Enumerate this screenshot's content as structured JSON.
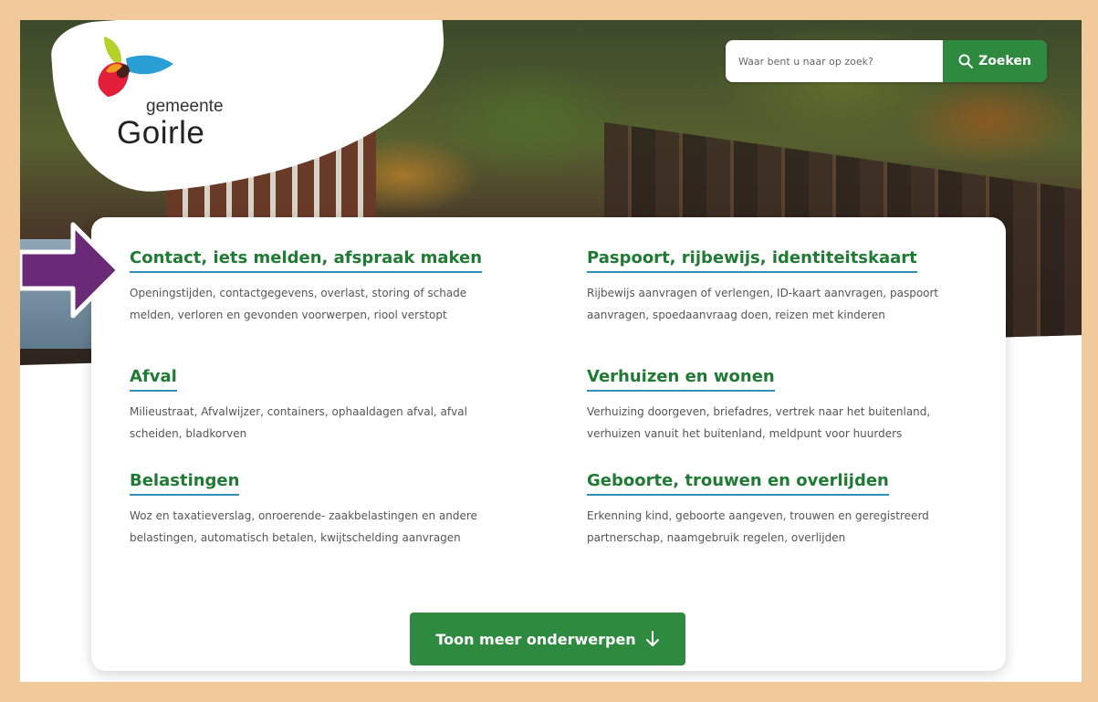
{
  "brand": {
    "name_small": "gemeente",
    "name_big": "Goirle"
  },
  "search": {
    "placeholder": "Waar bent u naar op zoek?",
    "button_label": "Zoeken"
  },
  "topics": [
    {
      "title": "Contact, iets melden, afspraak maken",
      "description": "Openingstijden, contactgegevens, overlast, storing of schade melden, verloren en gevonden voorwerpen, riool verstopt"
    },
    {
      "title": "Paspoort, rijbewijs, identiteitskaart",
      "description": "Rijbewijs aanvragen of verlengen, ID-kaart aanvragen, paspoort aanvragen, spoedaanvraag doen, reizen met kinderen"
    },
    {
      "title": "Afval",
      "description": "Milieustraat, Afvalwijzer, containers, ophaaldagen afval, afval scheiden, bladkorven"
    },
    {
      "title": "Verhuizen en wonen",
      "description": "Verhuizing doorgeven, briefadres, vertrek naar het buitenland, verhuizen vanuit het buitenland, meldpunt voor huurders"
    },
    {
      "title": "Belastingen",
      "description": "Woz en taxatieverslag, onroerende- zaakbelastingen en andere belastingen, automatisch betalen, kwijtschelding aanvragen"
    },
    {
      "title": "Geboorte, trouwen en overlijden",
      "description": "Erkenning kind, geboorte aangeven, trouwen en geregistreerd partnerschap, naamgebruik regelen, overlijden"
    }
  ],
  "more_button": {
    "label": "Toon meer onderwerpen",
    "icon": "arrow-down-icon"
  },
  "colors": {
    "border": "#f2c99a",
    "accent_green": "#2d8a3e",
    "link_green": "#1f7a33",
    "underline_blue": "#2e8fb8",
    "annotation_arrow": "#6b2a78"
  },
  "icons": {
    "search": "search-icon",
    "annotation": "pointer-arrow-icon"
  }
}
